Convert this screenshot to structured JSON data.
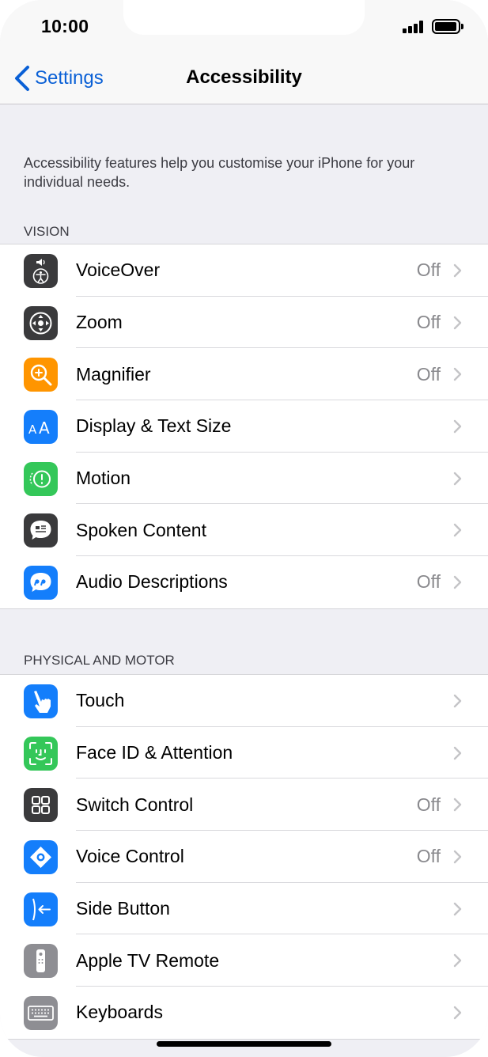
{
  "status_bar": {
    "time": "10:00"
  },
  "nav": {
    "back_label": "Settings",
    "title": "Accessibility"
  },
  "intro_text": "Accessibility features help you customise your iPhone for your individual needs.",
  "sections": [
    {
      "header": "VISION",
      "items": [
        {
          "label": "VoiceOver",
          "value": "Off",
          "icon": "voiceover-icon",
          "color": "#3a3a3c"
        },
        {
          "label": "Zoom",
          "value": "Off",
          "icon": "zoom-icon",
          "color": "#3a3a3c"
        },
        {
          "label": "Magnifier",
          "value": "Off",
          "icon": "magnifier-icon",
          "color": "#ff9500"
        },
        {
          "label": "Display & Text Size",
          "value": "",
          "icon": "display-text-size-icon",
          "color": "#147efb"
        },
        {
          "label": "Motion",
          "value": "",
          "icon": "motion-icon",
          "color": "#34c759"
        },
        {
          "label": "Spoken Content",
          "value": "",
          "icon": "spoken-content-icon",
          "color": "#3a3a3c"
        },
        {
          "label": "Audio Descriptions",
          "value": "Off",
          "icon": "audio-descriptions-icon",
          "color": "#147efb"
        }
      ]
    },
    {
      "header": "PHYSICAL AND MOTOR",
      "items": [
        {
          "label": "Touch",
          "value": "",
          "icon": "touch-icon",
          "color": "#147efb"
        },
        {
          "label": "Face ID & Attention",
          "value": "",
          "icon": "face-id-icon",
          "color": "#34c759"
        },
        {
          "label": "Switch Control",
          "value": "Off",
          "icon": "switch-control-icon",
          "color": "#3a3a3c"
        },
        {
          "label": "Voice Control",
          "value": "Off",
          "icon": "voice-control-icon",
          "color": "#147efb"
        },
        {
          "label": "Side Button",
          "value": "",
          "icon": "side-button-icon",
          "color": "#147efb"
        },
        {
          "label": "Apple TV Remote",
          "value": "",
          "icon": "apple-tv-remote-icon",
          "color": "#8e8e93"
        },
        {
          "label": "Keyboards",
          "value": "",
          "icon": "keyboards-icon",
          "color": "#8e8e93"
        }
      ]
    }
  ],
  "colors": {
    "accent": "#0a60d6",
    "background": "#efeff4",
    "secondary_text": "#8a8a8e"
  }
}
